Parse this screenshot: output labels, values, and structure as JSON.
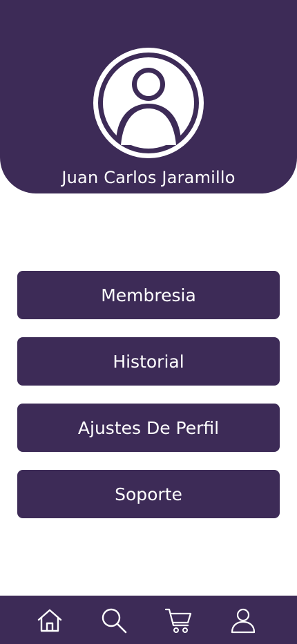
{
  "user": {
    "name": "Juan Carlos Jaramillo",
    "avatar_icon": "user-avatar-icon"
  },
  "menu": {
    "items": [
      {
        "label": "Membresia"
      },
      {
        "label": "Historial"
      },
      {
        "label": "Ajustes De Perfil"
      },
      {
        "label": "Soporte"
      }
    ]
  },
  "bottom_nav": {
    "items": [
      {
        "icon": "home-icon"
      },
      {
        "icon": "search-icon"
      },
      {
        "icon": "cart-icon"
      },
      {
        "icon": "profile-icon"
      }
    ]
  },
  "colors": {
    "primary": "#3d2b57",
    "text_on_primary": "#ffffff",
    "background": "#ffffff"
  }
}
